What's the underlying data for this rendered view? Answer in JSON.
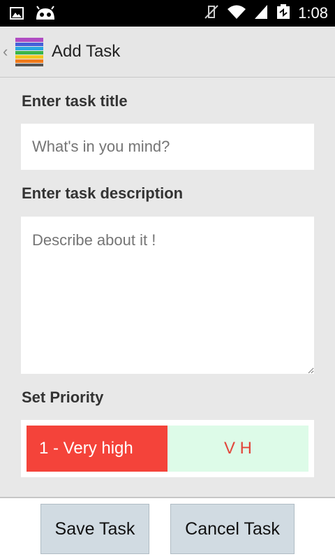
{
  "status_bar": {
    "time": "1:08",
    "icons": [
      "image-icon",
      "android-icon",
      "mute-icon",
      "wifi-icon",
      "signal-icon",
      "battery-icon"
    ]
  },
  "action_bar": {
    "title": "Add Task",
    "up_icon": "chevron-left-icon",
    "app_icon": "task-stack-icon"
  },
  "form": {
    "title_label": "Enter task title",
    "title_placeholder": "What's in you mind?",
    "title_value": "",
    "description_label": "Enter task description",
    "description_placeholder": "Describe about it !",
    "description_value": "",
    "priority_label": "Set Priority",
    "priority_selected": "1 - Very high",
    "priority_code": "V H"
  },
  "buttons": {
    "save": "Save Task",
    "cancel": "Cancel Task"
  },
  "colors": {
    "priority_selected_bg": "#f4433a",
    "priority_code_bg": "#ddfbe8",
    "button_bg": "#d1dbe2"
  }
}
